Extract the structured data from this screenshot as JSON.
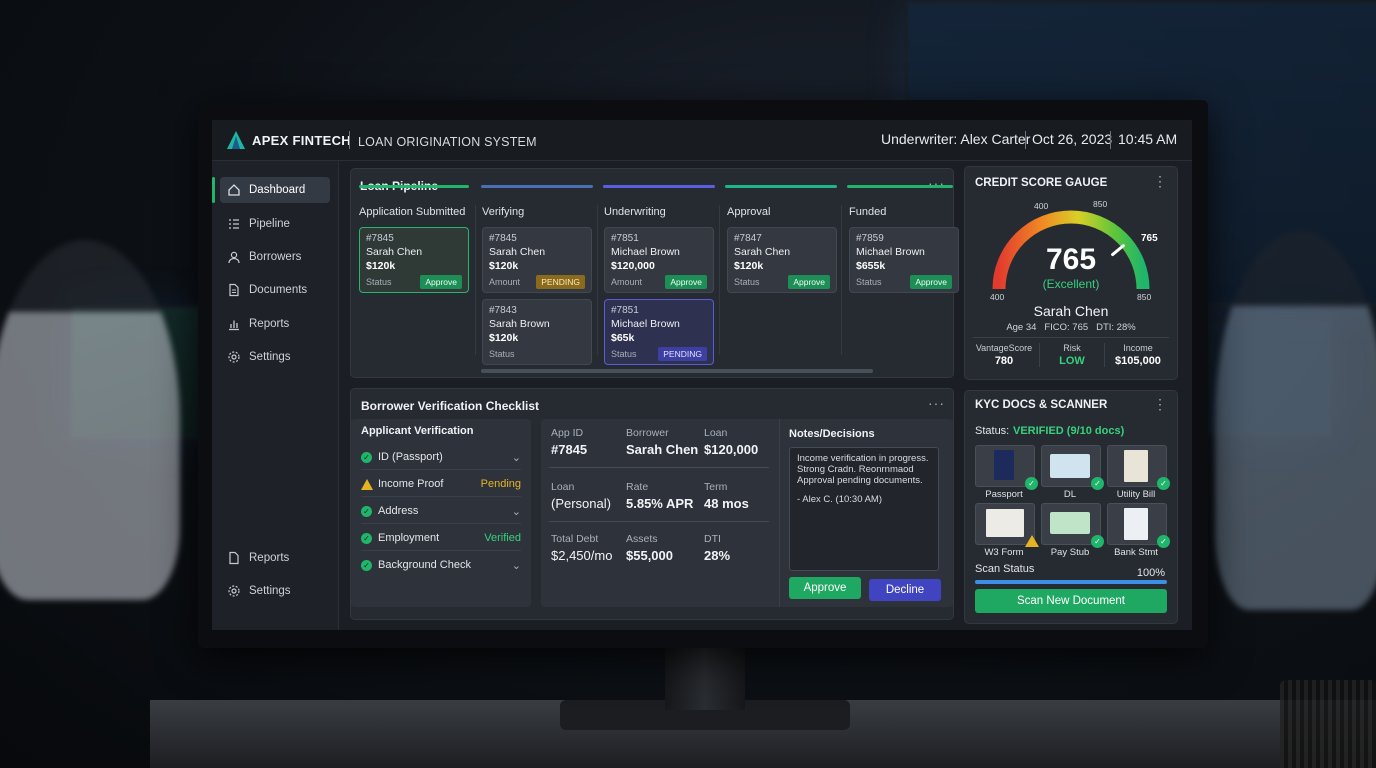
{
  "header": {
    "brand": "APEX FINTECH",
    "system": "LOAN ORIGINATION SYSTEM",
    "underwriter": "Underwriter: Alex Carter",
    "date": "Oct 26, 2023",
    "time": "10:45 AM"
  },
  "sidebar": {
    "items": [
      {
        "label": "Dashboard",
        "icon": "home-icon"
      },
      {
        "label": "Pipeline",
        "icon": "list-icon"
      },
      {
        "label": "Borrowers",
        "icon": "user-icon"
      },
      {
        "label": "Documents",
        "icon": "document-icon"
      },
      {
        "label": "Reports",
        "icon": "bar-chart-icon"
      },
      {
        "label": "Settings",
        "icon": "gear-icon"
      }
    ],
    "bottom": [
      {
        "label": "Reports",
        "icon": "document-icon"
      },
      {
        "label": "Settings",
        "icon": "gear-icon"
      }
    ]
  },
  "pipeline": {
    "title": "Loan Pipeline",
    "menu": "···",
    "columns": [
      {
        "title": "Application Submitted",
        "color": "#1fb56b"
      },
      {
        "title": "Verifying",
        "color": "#4a6fb5"
      },
      {
        "title": "Underwriting",
        "color": "#5c5ee0"
      },
      {
        "title": "Approval",
        "color": "#1fb58a"
      },
      {
        "title": "Funded",
        "color": "#1fb56b"
      }
    ],
    "cards": [
      {
        "id": "#7845",
        "name": "Sarah Chen",
        "amount": "$120k",
        "status": "Status",
        "badge": "Approve"
      },
      {
        "id": "#7845",
        "name": "Sarah Chen",
        "amount": "$120k",
        "status": "Amount",
        "badge": "PENDING"
      },
      {
        "id": "#7843",
        "name": "Sarah Brown",
        "amount": "$120k",
        "status": "Status",
        "badge": ""
      },
      {
        "id": "#7851",
        "name": "Michael Brown",
        "amount": "$120,000",
        "status": "Amount",
        "badge": "Approve"
      },
      {
        "id": "#7851",
        "name": "Michael Brown",
        "amount": "$65k",
        "status": "Status",
        "badge": "PENDING"
      },
      {
        "id": "#7847",
        "name": "Sarah Chen",
        "amount": "$120k",
        "status": "Status",
        "badge": "Approve"
      },
      {
        "id": "#7859",
        "name": "Michael Brown",
        "amount": "$655k",
        "status": "Status",
        "badge": "Approve"
      }
    ]
  },
  "credit": {
    "title": "CREDIT SCORE GAUGE",
    "menu": "⋮",
    "score": "765",
    "rating": "(Excellent)",
    "name": "Sarah Chen",
    "meta": "Age 34   FICO: 765   DTI: 28%",
    "ticks": {
      "min": "400",
      "mid": "400",
      "upper": "850",
      "max": "850",
      "marker": "765"
    },
    "fraction": 0.78,
    "stats": [
      {
        "label": "VantageScore",
        "value": "780"
      },
      {
        "label": "Risk",
        "value": "LOW"
      },
      {
        "label": "Income",
        "value": "$105,000"
      }
    ]
  },
  "checklist": {
    "title": "Borrower Verification Checklist",
    "menu": "···",
    "section": "Applicant Verification",
    "items": [
      {
        "label": "ID (Passport)",
        "right": "⌄"
      },
      {
        "label": "Income Proof",
        "right": "Pending"
      },
      {
        "label": "Address",
        "right": "⌄"
      },
      {
        "label": "Employment",
        "right": "Verified"
      },
      {
        "label": "Background Check",
        "right": "⌄"
      }
    ]
  },
  "details": {
    "app_id_label": "App ID",
    "app_id": "#7845",
    "borrower_label": "Borrower",
    "borrower": "Sarah Chen",
    "loan_label": "Loan",
    "loan": "$120,000",
    "loan_type_label": "Loan",
    "loan_type": "(Personal)",
    "rate_label": "Rate",
    "rate": "5.85% APR",
    "term_label": "Term",
    "term": "48 mos",
    "debt_label": "Total Debt",
    "debt": "$2,450/mo",
    "assets_label": "Assets",
    "assets": "$55,000",
    "dti_label": "DTI",
    "dti": "28%"
  },
  "notes": {
    "title": "Notes/Decisions",
    "text1": "Income verification in progress. Strong Cradn. Reonrnmaod Approval pending documents.",
    "text2": "- Alex C. (10:30 AM)",
    "approve": "Approve",
    "decline": "Decline"
  },
  "kyc": {
    "title": "KYC DOCS & SCANNER",
    "menu": "⋮",
    "status_label": "Status:",
    "status_value": "VERIFIED (9/10 docs)",
    "docs": [
      {
        "label": "Passport"
      },
      {
        "label": "DL"
      },
      {
        "label": "Utility Bill"
      },
      {
        "label": "W3 Form"
      },
      {
        "label": "Pay Stub"
      },
      {
        "label": "Bank Stmt"
      }
    ],
    "scan_label": "Scan Status",
    "scan_pct": "100%",
    "scan_fraction": 1.0,
    "scan_button": "Scan New Document"
  },
  "colors": {
    "accent": "#1fb56b",
    "warning": "#e6b422",
    "decline": "#4044c0",
    "pending_blue": "#3d3fa3"
  }
}
